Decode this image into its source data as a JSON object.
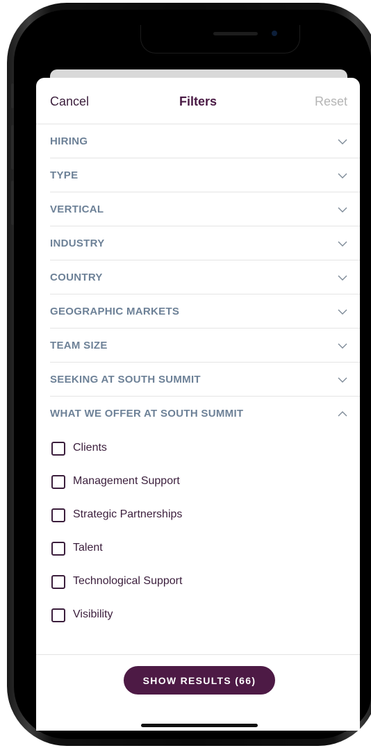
{
  "header": {
    "cancel": "Cancel",
    "title": "Filters",
    "reset": "Reset"
  },
  "filters": [
    {
      "label": "HIRING",
      "expanded": false
    },
    {
      "label": "TYPE",
      "expanded": false
    },
    {
      "label": "VERTICAL",
      "expanded": false
    },
    {
      "label": "INDUSTRY",
      "expanded": false
    },
    {
      "label": "COUNTRY",
      "expanded": false
    },
    {
      "label": "GEOGRAPHIC MARKETS",
      "expanded": false
    },
    {
      "label": "TEAM SIZE",
      "expanded": false
    },
    {
      "label": "SEEKING AT SOUTH SUMMIT",
      "expanded": false
    },
    {
      "label": "WHAT WE OFFER AT SOUTH SUMMIT",
      "expanded": true
    }
  ],
  "options": [
    {
      "label": "Clients",
      "checked": false
    },
    {
      "label": "Management Support",
      "checked": false
    },
    {
      "label": "Strategic Partnerships",
      "checked": false
    },
    {
      "label": "Talent",
      "checked": false
    },
    {
      "label": "Technological Support",
      "checked": false
    },
    {
      "label": "Visibility",
      "checked": false
    }
  ],
  "footer": {
    "show_results": "SHOW RESULTS (66)"
  },
  "colors": {
    "accent": "#4d1a45",
    "section_label": "#6d8197",
    "text": "#3b1e3c",
    "muted": "#b5b5b5"
  }
}
